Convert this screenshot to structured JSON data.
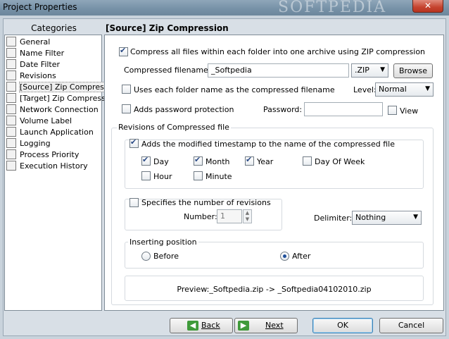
{
  "window": {
    "title": "Project Properties",
    "watermark": "SOFTPEDIA",
    "close_label": "✕"
  },
  "categories": {
    "header": "Categories",
    "items": [
      {
        "label": "General",
        "icon": "general-icon"
      },
      {
        "label": "Name Filter",
        "icon": "name-filter-icon"
      },
      {
        "label": "Date Filter",
        "icon": "date-filter-icon"
      },
      {
        "label": "Revisions",
        "icon": "revisions-icon"
      },
      {
        "label": "[Source] Zip Compress",
        "icon": "zip-icon"
      },
      {
        "label": "[Target] Zip Compress",
        "icon": "zip-icon"
      },
      {
        "label": "Network Connection",
        "icon": "network-icon"
      },
      {
        "label": "Volume Label",
        "icon": "volume-icon"
      },
      {
        "label": "Launch Application",
        "icon": "launch-icon"
      },
      {
        "label": "Logging",
        "icon": "logging-icon"
      },
      {
        "label": "Process Priority",
        "icon": "priority-icon"
      },
      {
        "label": "Execution History",
        "icon": "history-icon"
      }
    ],
    "selected_index": 4
  },
  "section": {
    "title": "[Source] Zip Compression",
    "compress_all": {
      "label": "Compress all files within each folder into one archive using ZIP compression",
      "checked": true
    },
    "filename": {
      "label": "Compressed filename:",
      "value": "_Softpedia",
      "extension": ".ZIP",
      "browse_label": "Browse"
    },
    "use_folder_name": {
      "label": "Uses each folder name as the compressed filename",
      "checked": false
    },
    "level": {
      "label": "Level:",
      "value": "Normal"
    },
    "password_protect": {
      "label": "Adds password protection",
      "checked": false
    },
    "password": {
      "label": "Password:",
      "value": "",
      "view_label": "View",
      "view_checked": false
    },
    "revisions": {
      "group_title": "Revisions of Compressed file",
      "timestamp": {
        "label": "Adds the modified timestamp to the name of the compressed file",
        "checked": true
      },
      "options": [
        {
          "label": "Day",
          "checked": true
        },
        {
          "label": "Month",
          "checked": true
        },
        {
          "label": "Year",
          "checked": true
        },
        {
          "label": "Day Of Week",
          "checked": false
        },
        {
          "label": "Hour",
          "checked": false
        },
        {
          "label": "Minute",
          "checked": false
        }
      ],
      "num_revisions": {
        "label": "Specifies the number of revisions",
        "checked": false,
        "number_label": "Number:",
        "number_value": "1"
      },
      "delimiter": {
        "label": "Delimiter:",
        "value": "Nothing"
      },
      "inserting": {
        "title": "Inserting position",
        "before": "Before",
        "after": "After",
        "selected": "After"
      },
      "preview": "Preview:_Softpedia.zip -> _Softpedia04102010.zip"
    }
  },
  "footer": {
    "back": "Back",
    "next": "Next",
    "ok": "OK",
    "cancel": "Cancel"
  },
  "colors": {
    "titlebar": "#7590a6",
    "close": "#c5432f",
    "nav_arrow": "#3f9a3a"
  }
}
